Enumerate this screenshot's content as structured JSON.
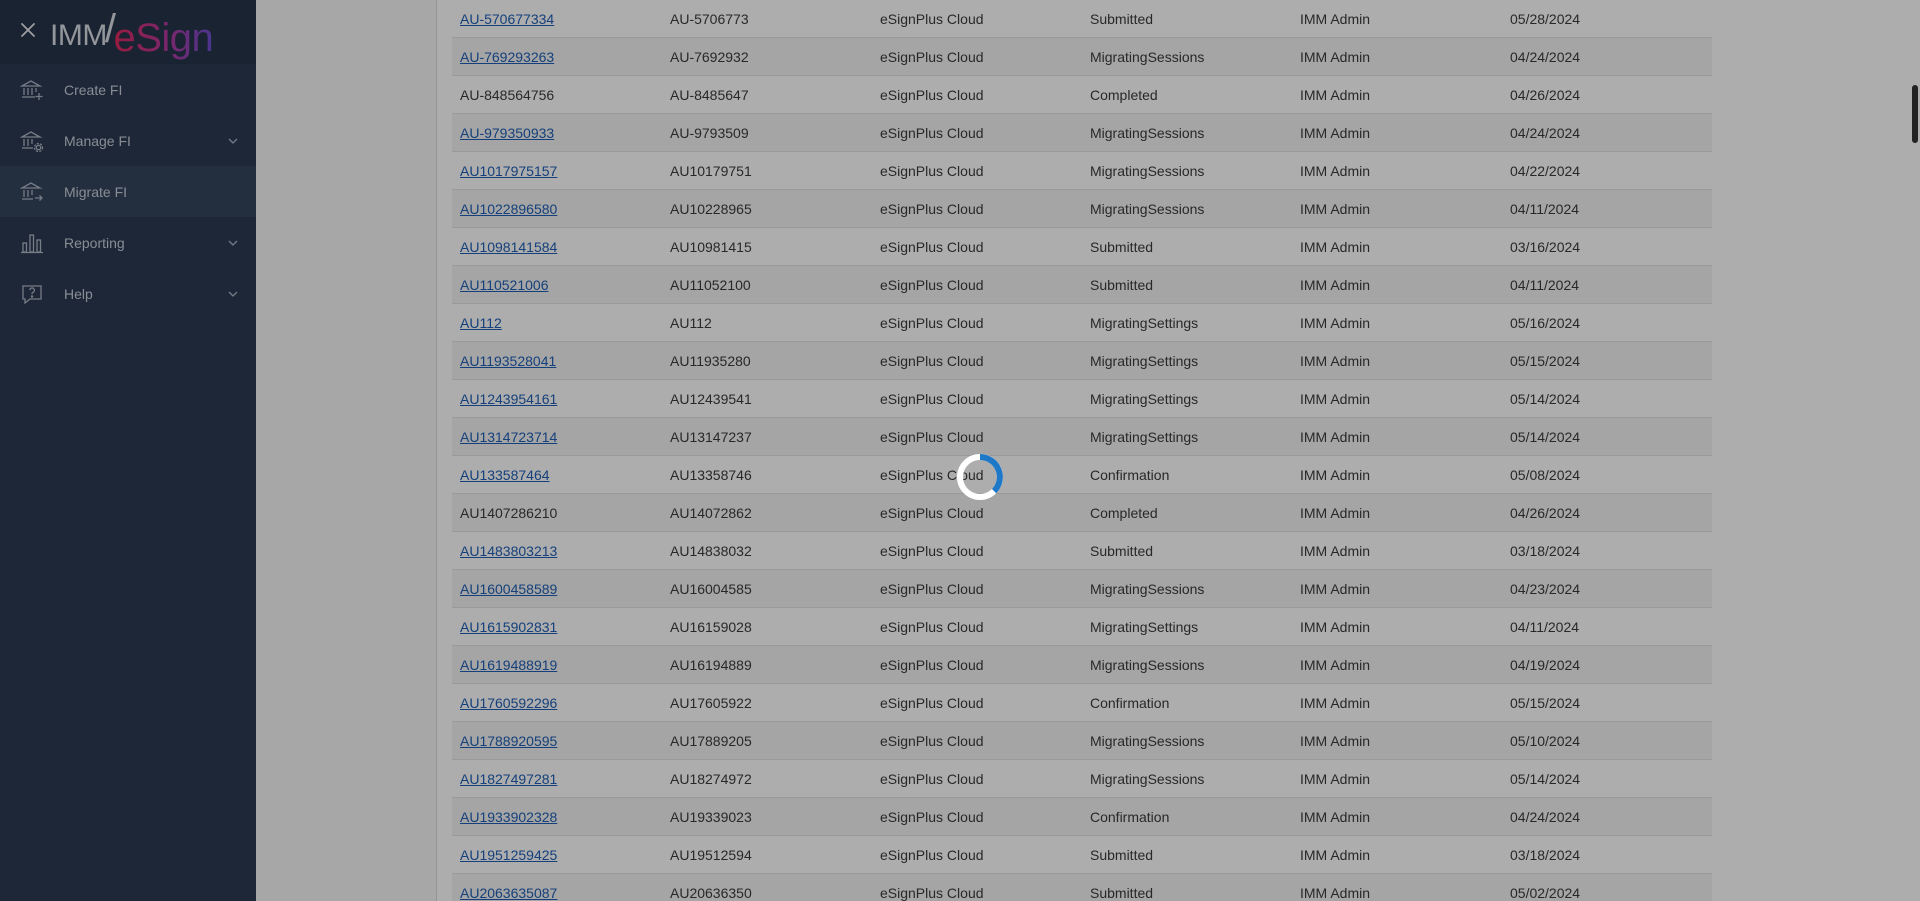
{
  "brand": {
    "prefix": "IMM",
    "slash": "/",
    "suffix": "eSign"
  },
  "sidebar": {
    "items": [
      {
        "label": "Create FI",
        "icon": "bank-plus-icon",
        "expandable": false,
        "active": false
      },
      {
        "label": "Manage FI",
        "icon": "bank-gear-icon",
        "expandable": true,
        "active": false
      },
      {
        "label": "Migrate FI",
        "icon": "bank-arrow-icon",
        "expandable": false,
        "active": true
      },
      {
        "label": "Reporting",
        "icon": "bar-chart-icon",
        "expandable": true,
        "active": false
      },
      {
        "label": "Help",
        "icon": "help-icon",
        "expandable": true,
        "active": false
      }
    ]
  },
  "table": {
    "rows": [
      {
        "id": "AU-570677334",
        "link": true,
        "code": "AU-5706773",
        "product": "eSignPlus Cloud",
        "status": "Submitted",
        "user": "IMM Admin",
        "date": "05/28/2024"
      },
      {
        "id": "AU-769293263",
        "link": true,
        "code": "AU-7692932",
        "product": "eSignPlus Cloud",
        "status": "MigratingSessions",
        "user": "IMM Admin",
        "date": "04/24/2024"
      },
      {
        "id": "AU-848564756",
        "link": false,
        "code": "AU-8485647",
        "product": "eSignPlus Cloud",
        "status": "Completed",
        "user": "IMM Admin",
        "date": "04/26/2024"
      },
      {
        "id": "AU-979350933",
        "link": true,
        "code": "AU-9793509",
        "product": "eSignPlus Cloud",
        "status": "MigratingSessions",
        "user": "IMM Admin",
        "date": "04/24/2024"
      },
      {
        "id": "AU1017975157",
        "link": true,
        "code": "AU10179751",
        "product": "eSignPlus Cloud",
        "status": "MigratingSessions",
        "user": "IMM Admin",
        "date": "04/22/2024"
      },
      {
        "id": "AU1022896580",
        "link": true,
        "code": "AU10228965",
        "product": "eSignPlus Cloud",
        "status": "MigratingSessions",
        "user": "IMM Admin",
        "date": "04/11/2024"
      },
      {
        "id": "AU1098141584",
        "link": true,
        "code": "AU10981415",
        "product": "eSignPlus Cloud",
        "status": "Submitted",
        "user": "IMM Admin",
        "date": "03/16/2024"
      },
      {
        "id": "AU110521006",
        "link": true,
        "code": "AU11052100",
        "product": "eSignPlus Cloud",
        "status": "Submitted",
        "user": "IMM Admin",
        "date": "04/11/2024"
      },
      {
        "id": "AU112",
        "link": true,
        "code": "AU112",
        "product": "eSignPlus Cloud",
        "status": "MigratingSettings",
        "user": "IMM Admin",
        "date": "05/16/2024"
      },
      {
        "id": "AU1193528041",
        "link": true,
        "code": "AU11935280",
        "product": "eSignPlus Cloud",
        "status": "MigratingSettings",
        "user": "IMM Admin",
        "date": "05/15/2024"
      },
      {
        "id": "AU1243954161",
        "link": true,
        "code": "AU12439541",
        "product": "eSignPlus Cloud",
        "status": "MigratingSettings",
        "user": "IMM Admin",
        "date": "05/14/2024"
      },
      {
        "id": "AU1314723714",
        "link": true,
        "code": "AU13147237",
        "product": "eSignPlus Cloud",
        "status": "MigratingSettings",
        "user": "IMM Admin",
        "date": "05/14/2024"
      },
      {
        "id": "AU133587464",
        "link": true,
        "code": "AU13358746",
        "product": "eSignPlus Cloud",
        "status": "Confirmation",
        "user": "IMM Admin",
        "date": "05/08/2024"
      },
      {
        "id": "AU1407286210",
        "link": false,
        "code": "AU14072862",
        "product": "eSignPlus Cloud",
        "status": "Completed",
        "user": "IMM Admin",
        "date": "04/26/2024"
      },
      {
        "id": "AU1483803213",
        "link": true,
        "code": "AU14838032",
        "product": "eSignPlus Cloud",
        "status": "Submitted",
        "user": "IMM Admin",
        "date": "03/18/2024"
      },
      {
        "id": "AU1600458589",
        "link": true,
        "code": "AU16004585",
        "product": "eSignPlus Cloud",
        "status": "MigratingSessions",
        "user": "IMM Admin",
        "date": "04/23/2024"
      },
      {
        "id": "AU1615902831",
        "link": true,
        "code": "AU16159028",
        "product": "eSignPlus Cloud",
        "status": "MigratingSettings",
        "user": "IMM Admin",
        "date": "04/11/2024"
      },
      {
        "id": "AU1619488919",
        "link": true,
        "code": "AU16194889",
        "product": "eSignPlus Cloud",
        "status": "MigratingSessions",
        "user": "IMM Admin",
        "date": "04/19/2024"
      },
      {
        "id": "AU1760592296",
        "link": true,
        "code": "AU17605922",
        "product": "eSignPlus Cloud",
        "status": "Confirmation",
        "user": "IMM Admin",
        "date": "05/15/2024"
      },
      {
        "id": "AU1788920595",
        "link": true,
        "code": "AU17889205",
        "product": "eSignPlus Cloud",
        "status": "MigratingSessions",
        "user": "IMM Admin",
        "date": "05/10/2024"
      },
      {
        "id": "AU1827497281",
        "link": true,
        "code": "AU18274972",
        "product": "eSignPlus Cloud",
        "status": "MigratingSessions",
        "user": "IMM Admin",
        "date": "05/14/2024"
      },
      {
        "id": "AU1933902328",
        "link": true,
        "code": "AU19339023",
        "product": "eSignPlus Cloud",
        "status": "Confirmation",
        "user": "IMM Admin",
        "date": "04/24/2024"
      },
      {
        "id": "AU1951259425",
        "link": true,
        "code": "AU19512594",
        "product": "eSignPlus Cloud",
        "status": "Submitted",
        "user": "IMM Admin",
        "date": "03/18/2024"
      },
      {
        "id": "AU2063635087",
        "link": true,
        "code": "AU20636350",
        "product": "eSignPlus Cloud",
        "status": "Submitted",
        "user": "IMM Admin",
        "date": "05/02/2024"
      }
    ]
  },
  "loading": {
    "icon": "loading-spinner-icon",
    "color": "#1e78c8"
  },
  "colors": {
    "sidebar_bg": "#2c3a52",
    "sidebar_header_bg": "#263449",
    "active_item_bg": "#34445d",
    "link": "#1f5fb5"
  }
}
